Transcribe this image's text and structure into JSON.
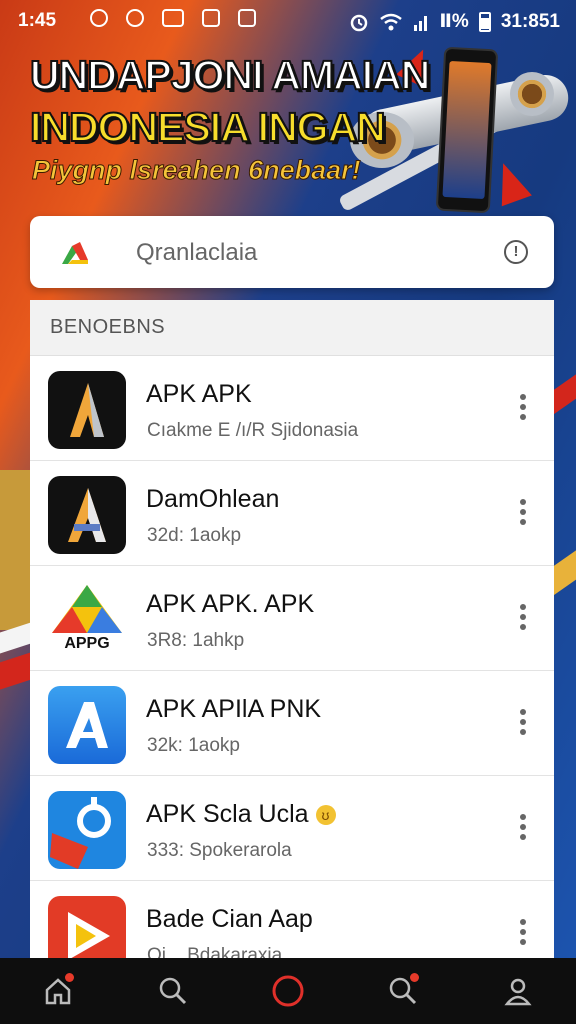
{
  "status_bar": {
    "time": "1:45",
    "battery": "Ⅱ%",
    "clock_right": "31:851"
  },
  "banner": {
    "line1": "UNDAPJONI AMAIAN",
    "line2": "INDONESIA INGAN",
    "line3": "Piygnp lsreahen 6nebaar!"
  },
  "search": {
    "value": "Qranlaclaia"
  },
  "section": {
    "title": "BENOEBNS"
  },
  "apps": [
    {
      "title": "APK APK",
      "subtitle": "Cıakme E /ı/R Sjidonasia",
      "icon": "a-logo-dark-icon"
    },
    {
      "title": "DamOhlean",
      "subtitle": "32d: 1aokp",
      "icon": "a-logo-dark-icon"
    },
    {
      "title": "APK APK. APK",
      "subtitle": "3R8: 1ahkp",
      "icon": "appg-logo-icon",
      "icon_text": "APPG"
    },
    {
      "title": "APK APIlA PNK",
      "subtitle": "32k: 1aokp",
      "icon": "app-store-icon"
    },
    {
      "title": "APK Scla Ucla",
      "subtitle": "333: Spokerarola",
      "icon": "blue-camera-icon",
      "badge_text": "ʊ"
    },
    {
      "title": "Bade Cian Aap",
      "subtitle": "Oi... Bdakaraxia",
      "icon": "play-icon"
    }
  ],
  "nav": {
    "items": [
      "home-icon",
      "search-icon",
      "record-icon",
      "notifications-icon",
      "profile-icon"
    ]
  },
  "colors": {
    "accent_red": "#d92518",
    "banner_yellow": "#f7dd2c",
    "nav_bg": "#0e0e0e"
  }
}
